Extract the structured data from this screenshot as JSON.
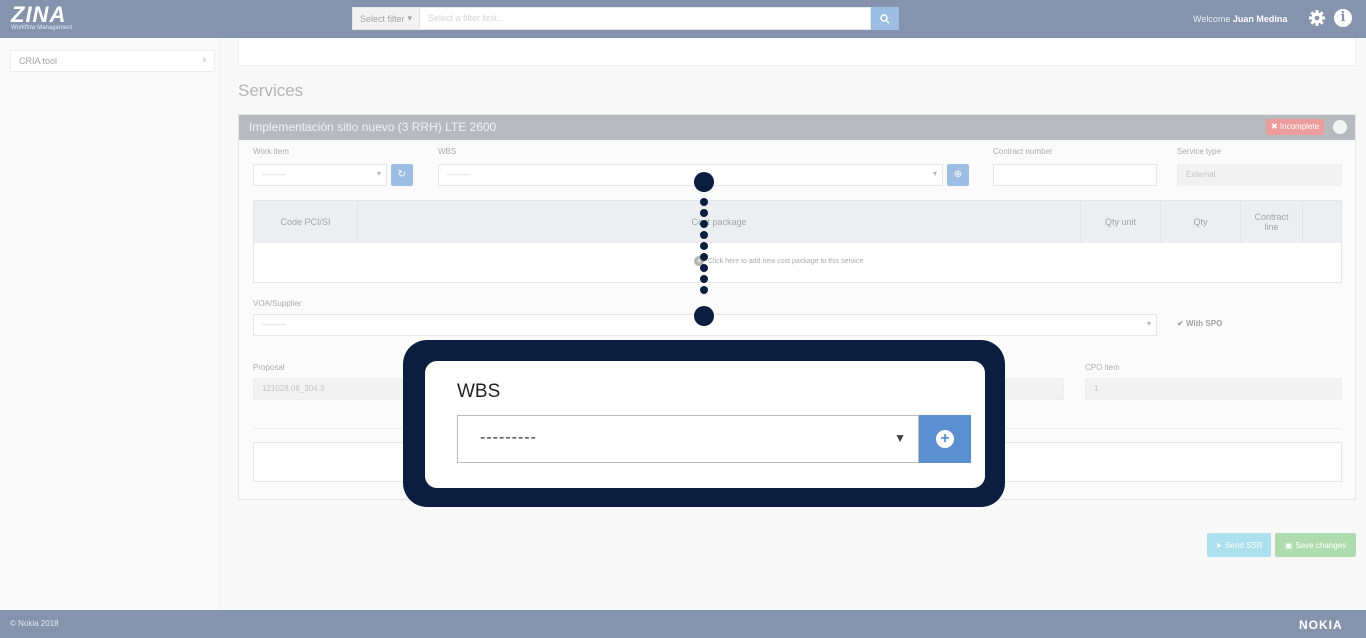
{
  "header": {
    "logo_main": "ZINA",
    "logo_sub": "Workflow Management",
    "filter_button": "Select filter",
    "filter_placeholder": "Select a filter first...",
    "welcome_prefix": "Welcome",
    "user_name": "Juan Medina"
  },
  "sidebar": {
    "items": [
      {
        "label": "CRIA tool"
      }
    ]
  },
  "main": {
    "section_title": "Services",
    "panel": {
      "title": "Implementación sitio nuevo (3 RRH) LTE 2600",
      "status_badge": "✖ Incomplete",
      "fields": {
        "work_item_label": "Work item",
        "work_item_value": "---------",
        "wbs_label": "WBS",
        "wbs_value": "---------",
        "contract_number_label": "Contract number",
        "service_type_label": "Service type",
        "service_type_value": "External",
        "voa_label": "VOA/Supplier",
        "voa_value": "---------",
        "with_spo_label": "With SPO",
        "proposal_label": "Proposal",
        "proposal_value": "121028.06_304.3",
        "cpo_item_label": "CPO item",
        "cpo_item_value": "1"
      },
      "cost_table": {
        "columns": [
          "Code PCI/SI",
          "Cost package",
          "Qty unit",
          "Qty",
          "Contract line"
        ],
        "add_text": "Click here to add new cost package to this service"
      }
    },
    "actions": {
      "send_label": "Send SSR",
      "save_label": "Save changes"
    }
  },
  "footer": {
    "copyright": "© Nokia 2018",
    "brand": "NOKIA"
  },
  "callout": {
    "label": "WBS",
    "select_value": "---------"
  },
  "colors": {
    "navy": "#0b2858",
    "primary_blue": "#3d7ac7",
    "danger": "#d9383a",
    "success": "#5cb85c",
    "info": "#5bc0de"
  }
}
